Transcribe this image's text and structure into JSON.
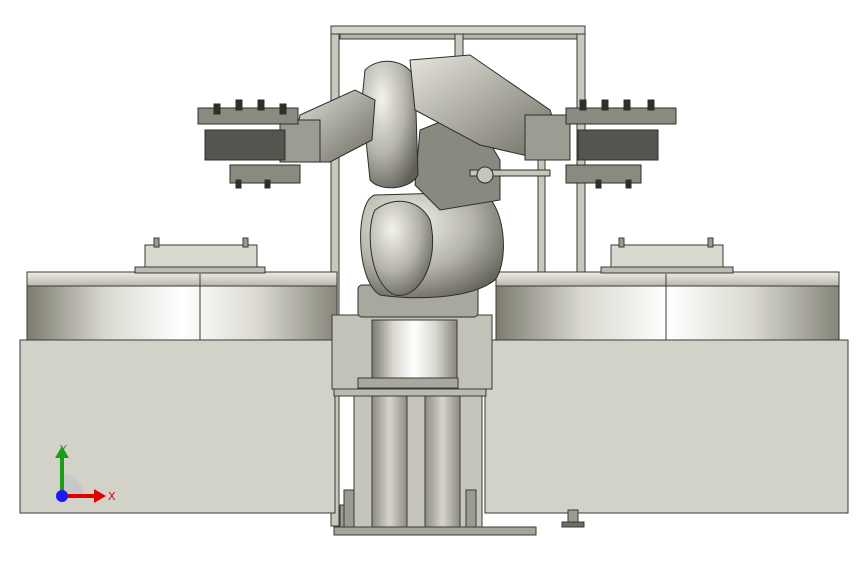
{
  "viewport": {
    "background": "#ffffff",
    "body_color": "#d3d2c9",
    "edge_color": "#3a3a36",
    "metal_light": "#f2f1ea",
    "metal_mid": "#b9b8ae",
    "metal_dark": "#6f6e66"
  },
  "triad": {
    "x_label": "X",
    "y_label": "Y",
    "x_color": "#e00000",
    "y_color": "#1a9e1a",
    "z_color": "#1a1aff"
  }
}
